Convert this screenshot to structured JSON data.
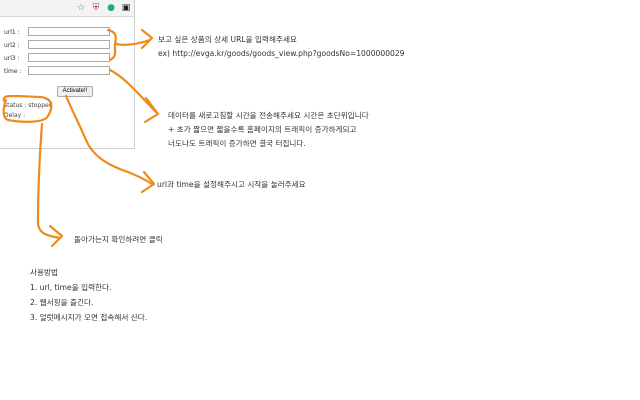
{
  "popup": {
    "labels": {
      "url1": "url1 :",
      "url2": "url2 :",
      "url3": "url3 :",
      "time": "time :"
    },
    "inputs": {
      "url1": "",
      "url2": "",
      "url3": "",
      "time": ""
    },
    "activate_button": "Activate!!",
    "status": "status : stopped",
    "delay": "Delay :"
  },
  "annotations": {
    "url_line1": "보고 싶은 상품의 상세 URL을 입력해주세요",
    "url_line2": "ex) http://evga.kr/goods/goods_view.php?goodsNo=1000000029",
    "time_line1": "데이터를 새로고침할 시간을 전송해주세요 시간은 초단위입니다",
    "time_line2": "+ 초가 짧으면 짧을수록 홈페이지의 트래픽이 증가하게되고",
    "time_line3": "너도나도 트래픽이 증가하면 결국 터집니다.",
    "activate_note": "url과 time을 설정해주시고 시작을 눌러주세요",
    "status_note": "돌아가는지 확인하려면 클릭"
  },
  "usage": {
    "title": "사용방법",
    "steps": [
      "1. url, time을 입력한다.",
      "2. 웹서핑을 즐긴다.",
      "3. 얼럿메시지가 오면 접속해서 산다."
    ]
  },
  "colors": {
    "annotation": "#f08a1c"
  }
}
